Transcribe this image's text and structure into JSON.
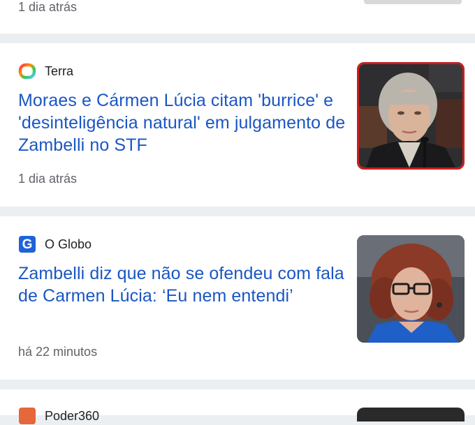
{
  "articles": [
    {
      "time": "1 dia atrás"
    },
    {
      "source": "Terra",
      "source_icon": "terra-logo-icon",
      "headline": "Moraes e Cármen Lúcia citam 'burrice' e 'desinteligência natural' em julgamento de Zambelli no STF",
      "time": "1 dia atrás",
      "thumbnail": "woman-grey-hair-photo"
    },
    {
      "source": "O Globo",
      "source_icon": "globo-logo-icon",
      "headline": "Zambelli diz que não se ofendeu com fala de Carmen Lúcia: ‘Eu nem entendi’",
      "time": "há 22 minutos",
      "thumbnail": "woman-curly-hair-photo"
    },
    {
      "source": "Poder360",
      "source_icon": "poder360-logo-icon"
    }
  ],
  "colors": {
    "headline": "#1a56c4",
    "meta": "#5f6368",
    "background": "#eceff1"
  }
}
